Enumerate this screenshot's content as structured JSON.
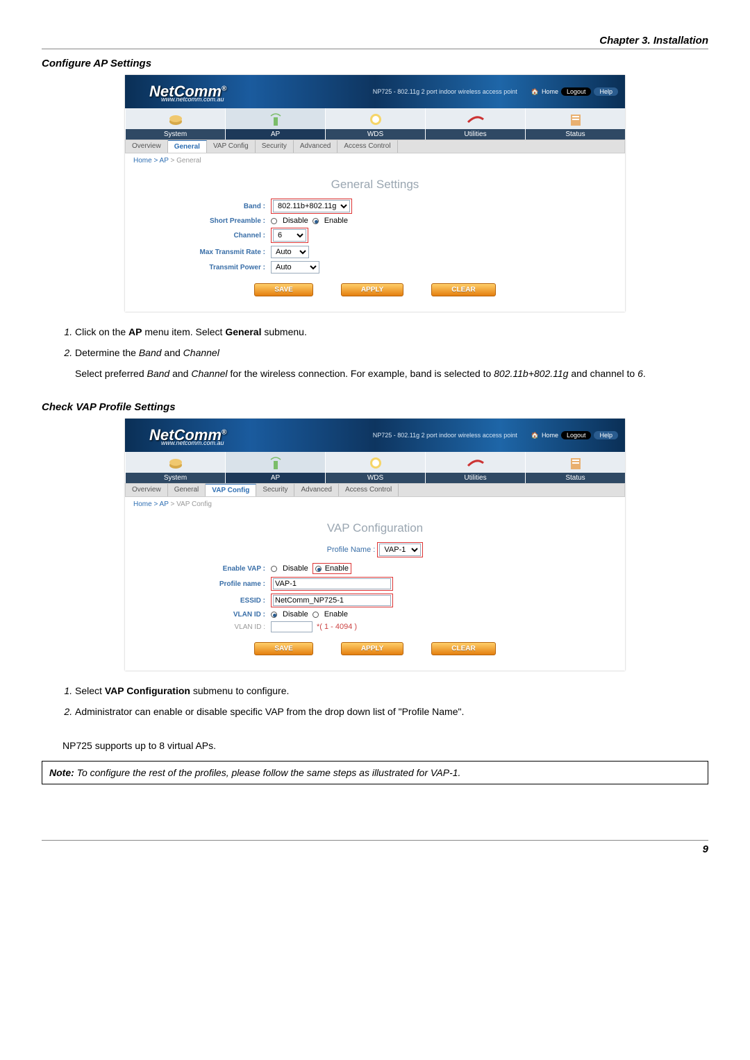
{
  "chapter_header": "Chapter 3. Installation",
  "page_number": "9",
  "section1": {
    "title": "Configure AP Settings",
    "steps": {
      "s1_a": "Click on the ",
      "s1_b": "AP",
      "s1_c": " menu item. Select ",
      "s1_d": "General",
      "s1_e": " submenu.",
      "s2_a": "Determine the ",
      "s2_b": "Band",
      "s2_c": " and ",
      "s2_d": "Channel",
      "s2_body_a": "Select preferred ",
      "s2_body_b": "Band",
      "s2_body_c": " and ",
      "s2_body_d": "Channel",
      "s2_body_e": " for the wireless connection. For example, band is selected to ",
      "s2_body_f": "802.11b+802.11g",
      "s2_body_g": " and channel to ",
      "s2_body_h": "6",
      "s2_body_i": "."
    }
  },
  "section2": {
    "title": "Check VAP Profile Settings",
    "steps": {
      "s1_a": "Select ",
      "s1_b": "VAP Configuration",
      "s1_c": " submenu to configure.",
      "s2": "Administrator can enable or disable specific VAP from the drop down list of \"Profile Name\".",
      "trailing": "NP725 supports up to 8 virtual APs."
    },
    "note_label": "Note:",
    "note_body": " To configure the rest of the profiles, please follow the same steps as illustrated for VAP-1."
  },
  "router": {
    "logo": "NetComm",
    "logo_r": "®",
    "logo_sub": "www.netcomm.com.au",
    "tagline": "NP725 - 802.11g 2 port indoor wireless access point",
    "home": "Home",
    "logout": "Logout",
    "help": "Help",
    "nav": {
      "system": "System",
      "ap": "AP",
      "wds": "WDS",
      "utilities": "Utilities",
      "status": "Status"
    },
    "tabs": {
      "overview": "Overview",
      "general": "General",
      "vap_config": "VAP Config",
      "security": "Security",
      "advanced": "Advanced",
      "access_control": "Access Control"
    },
    "buttons": {
      "save": "SAVE",
      "apply": "APPLY",
      "clear": "CLEAR"
    },
    "breadcrumb_general_a": "Home",
    "breadcrumb_general_b": " > ",
    "breadcrumb_general_c": "AP",
    "breadcrumb_general_d": " > General",
    "breadcrumb_vap_a": "Home",
    "breadcrumb_vap_b": " > ",
    "breadcrumb_vap_c": "AP",
    "breadcrumb_vap_d": " > VAP Config"
  },
  "general_form": {
    "title": "General Settings",
    "labels": {
      "band": "Band :",
      "short_preamble": "Short Preamble :",
      "channel": "Channel :",
      "max_tx_rate": "Max Transmit Rate :",
      "tx_power": "Transmit Power :"
    },
    "values": {
      "band": "802.11b+802.11g",
      "channel": "6",
      "max_tx_rate": "Auto",
      "tx_power": "Auto",
      "disable": "Disable",
      "enable": "Enable"
    }
  },
  "vap_form": {
    "title": "VAP Configuration",
    "labels": {
      "profile_select": "Profile Name :",
      "enable_vap": "Enable VAP :",
      "profile_name": "Profile name :",
      "essid": "ESSID :",
      "vlan_id": "VLAN ID :",
      "vlan_id2": "VLAN ID :"
    },
    "values": {
      "profile_select": "VAP-1",
      "profile_name": "VAP-1",
      "essid": "NetComm_NP725-1",
      "vlan_hint": "*( 1 - 4094 )",
      "disable": "Disable",
      "enable": "Enable"
    }
  }
}
